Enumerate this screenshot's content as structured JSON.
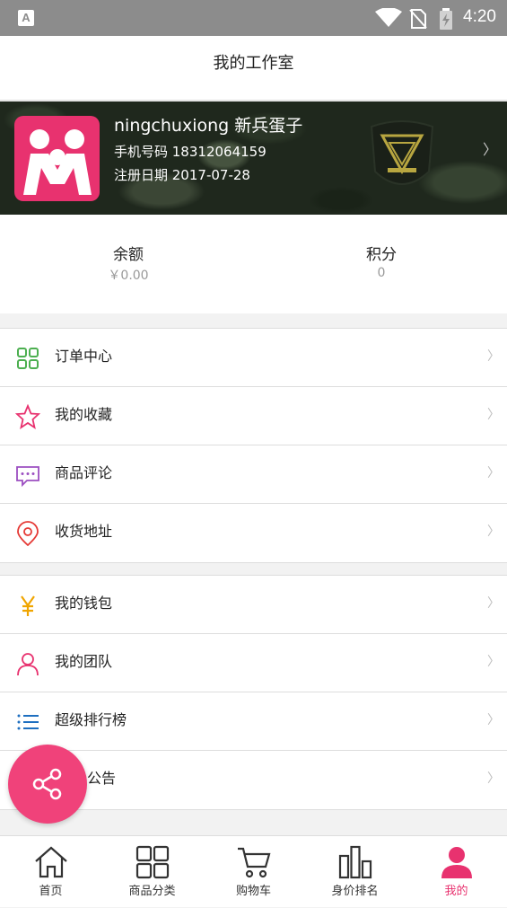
{
  "status_bar": {
    "notification_icon": "A",
    "time": "4:20",
    "icons": [
      "wifi-icon",
      "no-sim-icon",
      "battery-charging-icon"
    ]
  },
  "header": {
    "title": "我的工作室"
  },
  "profile": {
    "name": "ningchuxiong 新兵蛋子",
    "phone": "手机号码 18312064159",
    "register_date": "注册日期 2017-07-28",
    "chevron": "〉",
    "avatar_icon": "team-logo-icon",
    "rank_icon": "rank-emblem-icon"
  },
  "stats": {
    "balance": {
      "label": "余额",
      "value": "￥0.00"
    },
    "points": {
      "label": "积分",
      "value": "0"
    }
  },
  "menu_group_1": [
    {
      "label": "订单中心",
      "icon": "grid-icon",
      "color": "#4caf50"
    },
    {
      "label": "我的收藏",
      "icon": "star-icon",
      "color": "#e8326f"
    },
    {
      "label": "商品评论",
      "icon": "comment-icon",
      "color": "#9c4fc1"
    },
    {
      "label": "收货地址",
      "icon": "location-icon",
      "color": "#e53935"
    }
  ],
  "menu_group_2": [
    {
      "label": "我的钱包",
      "icon": "yen-icon",
      "color": "#f0a500"
    },
    {
      "label": "我的团队",
      "icon": "user-icon",
      "color": "#e8326f"
    },
    {
      "label": "超级排行榜",
      "icon": "list-icon",
      "color": "#1e6fc0"
    },
    {
      "label": "公告",
      "icon": "announcement-icon",
      "color": "#333333"
    }
  ],
  "menu_arrow": "〉",
  "tabs": [
    {
      "label": "首页",
      "icon": "home-icon"
    },
    {
      "label": "商品分类",
      "icon": "category-icon"
    },
    {
      "label": "购物车",
      "icon": "cart-icon"
    },
    {
      "label": "身价排名",
      "icon": "ranking-icon"
    },
    {
      "label": "我的",
      "icon": "user-filled-icon",
      "active": true
    }
  ],
  "fab": {
    "icon": "share-icon"
  },
  "colors": {
    "accent": "#e8326f",
    "fab": "#f0427a"
  }
}
